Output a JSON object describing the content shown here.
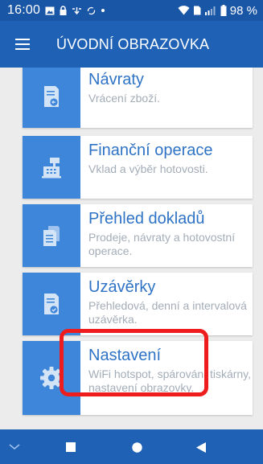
{
  "status_bar": {
    "time": "16:00",
    "battery": "98 %",
    "icons": [
      "image-icon",
      "lock-icon",
      "cast-icon",
      "sync-icon",
      "dot-icon",
      "wifi-icon",
      "sim-icon",
      "signal-icon",
      "battery-icon"
    ]
  },
  "app_bar": {
    "title": "ÚVODNÍ OBRAZOVKA",
    "menu_icon": "menu-icon"
  },
  "menu_items": [
    {
      "title": "Návraty",
      "subtitle": "Vrácení zboží.",
      "icon": "receipt-return-icon"
    },
    {
      "title": "Finanční operace",
      "subtitle": "Vklad a výběr hotovosti.",
      "icon": "cash-register-icon"
    },
    {
      "title": "Přehled dokladů",
      "subtitle": "Prodeje, návraty a hotovostní operace.",
      "icon": "documents-icon"
    },
    {
      "title": "Uzávěrky",
      "subtitle": "Přehledová, denní a intervalová uzávěrka.",
      "icon": "receipt-check-icon"
    },
    {
      "title": "Nastavení",
      "subtitle": "WiFi hotspot, spárování tiskárny, nastavení obrazovky.",
      "icon": "gear-icon"
    }
  ],
  "nav_bar": {
    "buttons": [
      "down-chevron-icon",
      "recents-icon",
      "home-icon",
      "back-icon"
    ]
  },
  "colors": {
    "status_bar": "#1a56a6",
    "app_bar": "#1f62b5",
    "icon_tile": "#3d86d9",
    "title_text": "#2e73c5",
    "subtitle_text": "#a3adb8",
    "highlight": "#ee1c1c"
  }
}
